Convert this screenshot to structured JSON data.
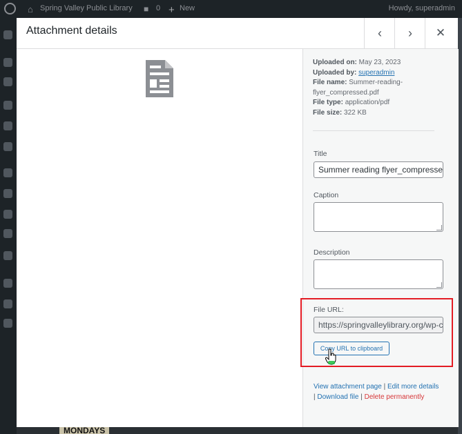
{
  "admin_bar": {
    "site_name": "Spring Valley Public Library",
    "comments_count": "0",
    "new_label": "New",
    "howdy": "Howdy, superadmin"
  },
  "modal": {
    "title": "Attachment details",
    "nav": {
      "prev_icon": "‹",
      "next_icon": "›",
      "close_icon": "✕"
    }
  },
  "details": {
    "uploaded_on_label": "Uploaded on:",
    "uploaded_on": "May 23, 2023",
    "uploaded_by_label": "Uploaded by:",
    "uploaded_by": "superadmin",
    "file_name_label": "File name:",
    "file_name": "Summer-reading-flyer_compressed.pdf",
    "file_type_label": "File type:",
    "file_type": "application/pdf",
    "file_size_label": "File size:",
    "file_size": "322 KB"
  },
  "fields": {
    "title_label": "Title",
    "title_value": "Summer reading flyer_compressed",
    "caption_label": "Caption",
    "caption_value": "",
    "description_label": "Description",
    "description_value": "",
    "file_url_label": "File URL:",
    "file_url_value": "https://springvalleylibrary.org/wp-content/uploads",
    "copy_button": "Copy URL to clipboard"
  },
  "links": {
    "view_page": "View attachment page",
    "edit_details": "Edit more details",
    "download": "Download file",
    "delete": "Delete permanently",
    "separator": "|"
  },
  "backdrop": {
    "poster_text": "MONDAYS"
  },
  "colors": {
    "link": "#2271b1",
    "danger": "#d63638",
    "highlight": "#e31b23",
    "admin_bar": "#1d2327"
  }
}
